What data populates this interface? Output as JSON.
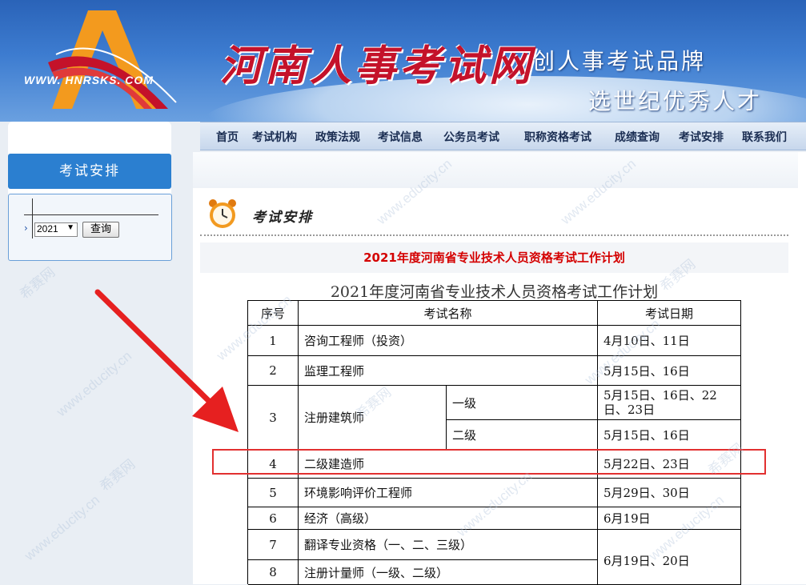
{
  "site": {
    "logo_text": "WWW. HNRSKS. COM",
    "title": "河南人事考试网",
    "slogan_1": "创人事考试品牌",
    "slogan_2": "选世纪优秀人才"
  },
  "nav": {
    "items": [
      "首页",
      "考试机构",
      "政策法规",
      "考试信息",
      "公务员考试",
      "职称资格考试",
      "成绩查询",
      "考试安排",
      "联系我们"
    ]
  },
  "sidebar": {
    "title": "考试安排",
    "year_value": "2021",
    "query_label": "查询"
  },
  "main": {
    "section_title": "考试安排",
    "red_title": "2021年度河南省专业技术人员资格考试工作计划",
    "table_title": "2021年度河南省专业技术人员资格考试工作计划",
    "headers": [
      "序号",
      "考试名称",
      "考试日期"
    ],
    "rows": [
      {
        "no": "1",
        "name": "咨询工程师（投资）",
        "date": "4月10日、11日"
      },
      {
        "no": "2",
        "name": "监理工程师",
        "date": "5月15日、16日"
      },
      {
        "no": "3",
        "name": "注册建筑师",
        "sub": [
          {
            "level": "一级",
            "date": "5月15日、16日、22日、23日"
          },
          {
            "level": "二级",
            "date": "5月15日、16日"
          }
        ]
      },
      {
        "no": "4",
        "name": "二级建造师",
        "date": "5月22日、23日"
      },
      {
        "no": "5",
        "name": "环境影响评价工程师",
        "date": "5月29日、30日"
      },
      {
        "no": "6",
        "name": "经济（高级）",
        "date": "6月19日"
      },
      {
        "no": "7",
        "name": "翻译专业资格（一、二、三级）",
        "date": "6月19日、20日"
      },
      {
        "no": "8",
        "name": "注册计量师（一级、二级）",
        "date": ""
      }
    ]
  },
  "colors": {
    "header_blue": "#2a63b8",
    "site_title_red": "#c4122a",
    "red_title": "#d40000",
    "highlight_red": "#e23030",
    "sidebar_blue": "#2b7fd0"
  },
  "watermark": {
    "text_cn": "希赛网",
    "text_en": "www.educity.cn"
  }
}
